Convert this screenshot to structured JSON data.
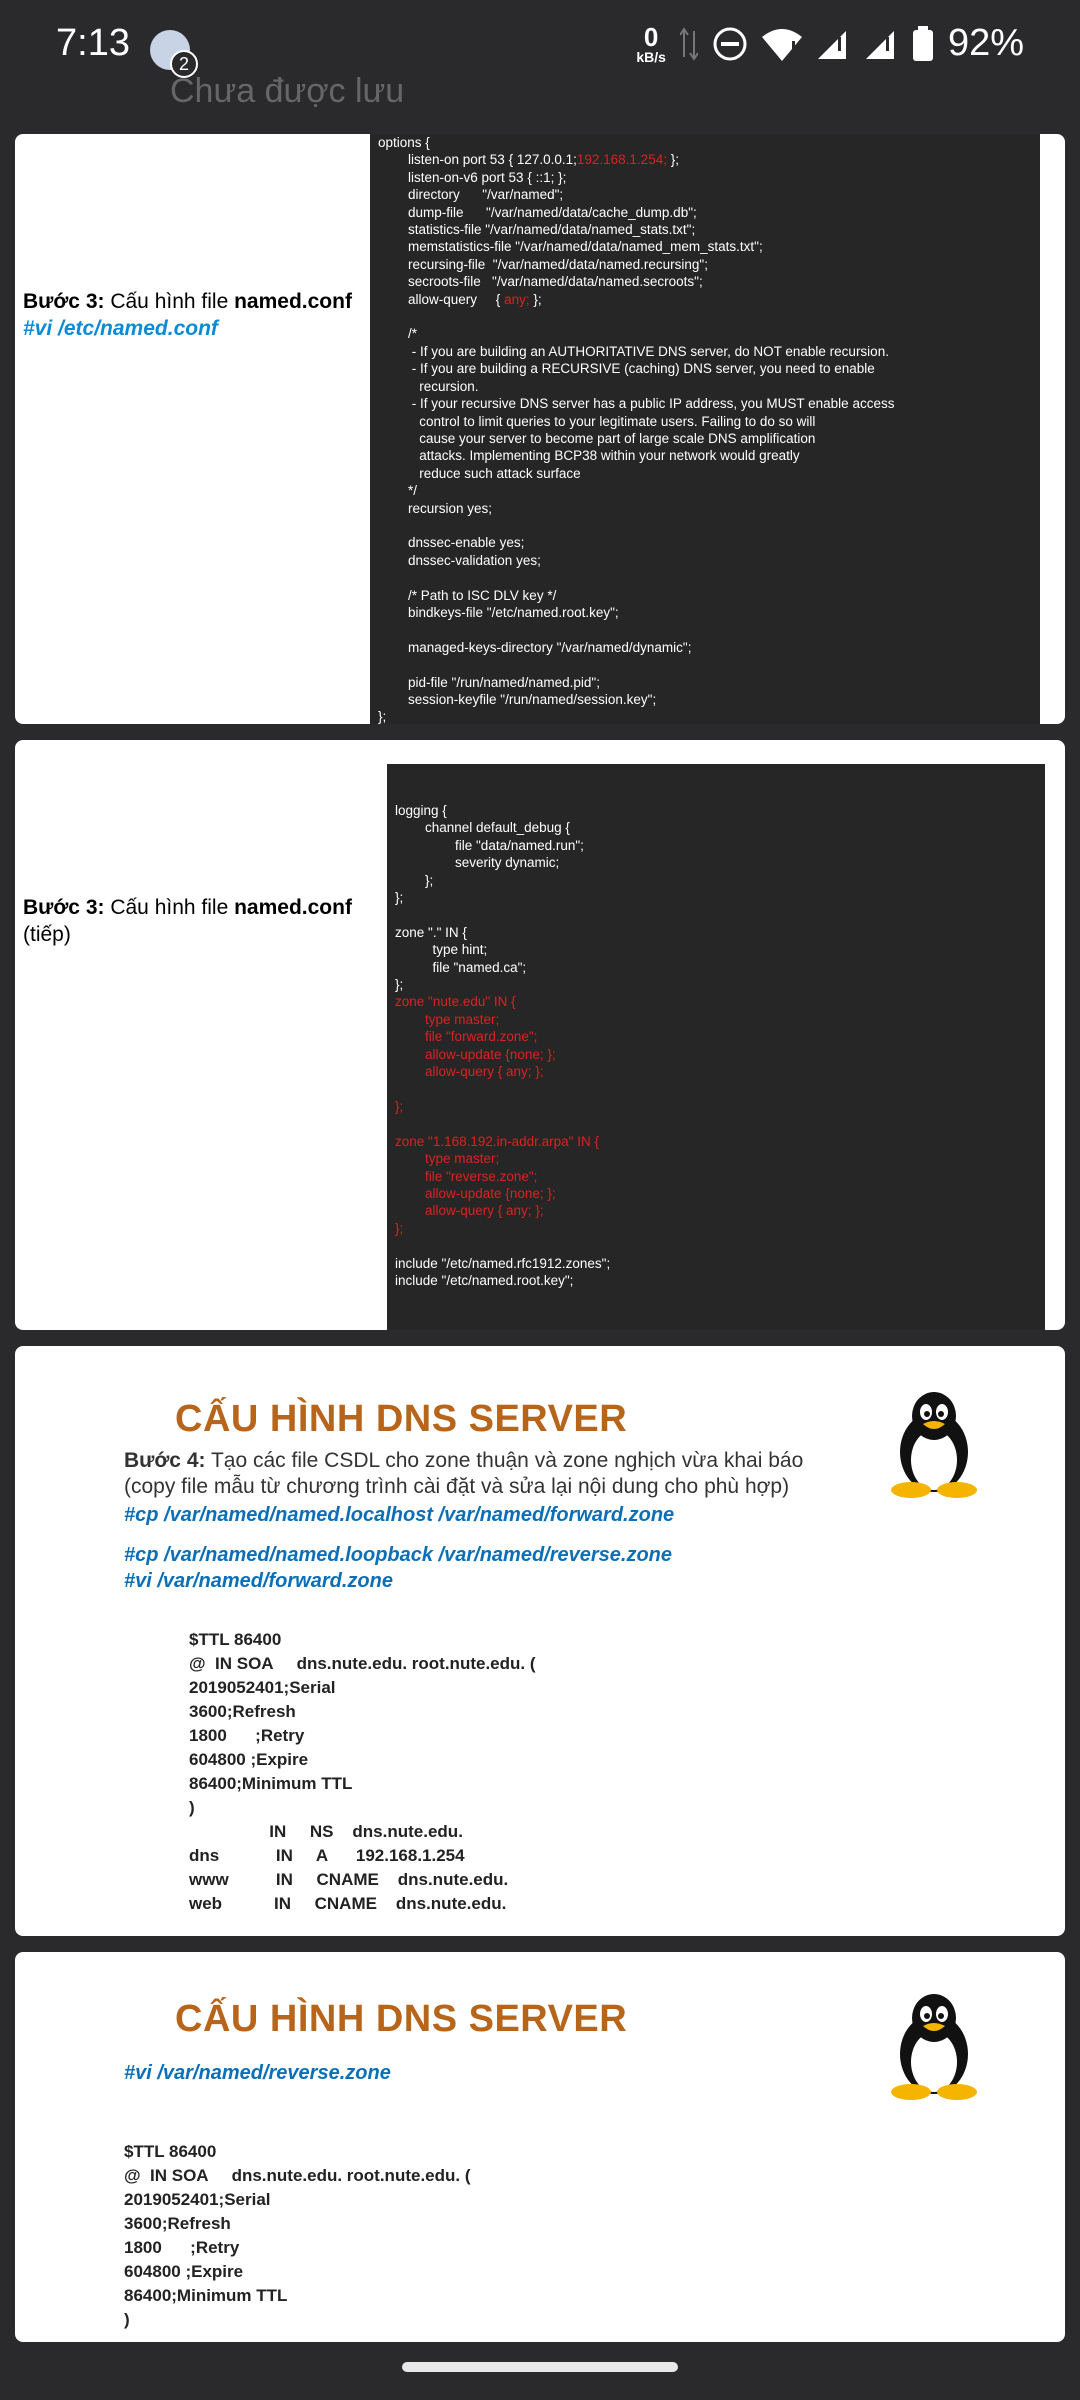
{
  "status_bar": {
    "time": "7:13",
    "notification_count": "2",
    "net_speed_value": "0",
    "net_speed_unit": "kB/s",
    "battery": "92%"
  },
  "header": {
    "ghost_title": "Chưa được lưu"
  },
  "slide1": {
    "step_bold": "Bước 3:",
    "step_text": " Cấu hình file ",
    "step_file": "named.conf",
    "command": "#vi /etc/named.conf"
  },
  "slide2": {
    "step_bold": "Bước 3:",
    "step_text": " Cấu hình file ",
    "step_file": "named.conf",
    "step_suffix": "(tiếp)"
  },
  "slide3": {
    "title": "CẤU HÌNH DNS SERVER",
    "step_bold": "Bước 4:",
    "step_text": "  Tạo các file CSDL cho zone thuận và zone nghịch vừa khai báo",
    "step_note": "(copy file mẫu từ chương trình cài đặt và sửa lại nội dung cho phù hợp)",
    "cmd1": "#cp /var/named/named.localhost /var/named/forward.zone",
    "cmd2": "#cp /var/named/named.loopback /var/named/reverse.zone",
    "cmd3": "#vi /var/named/forward.zone"
  },
  "slide4": {
    "title": "CẤU HÌNH DNS SERVER",
    "command": "#vi /var/named/reverse.zone"
  },
  "icons": [
    "penguin-icon",
    "wifi-icon",
    "signal-icon",
    "battery-icon",
    "dnd-icon"
  ],
  "colors": {
    "title_orange": "#b8651c",
    "command_blue": "#0b6fb8",
    "code_red": "#e02020"
  }
}
